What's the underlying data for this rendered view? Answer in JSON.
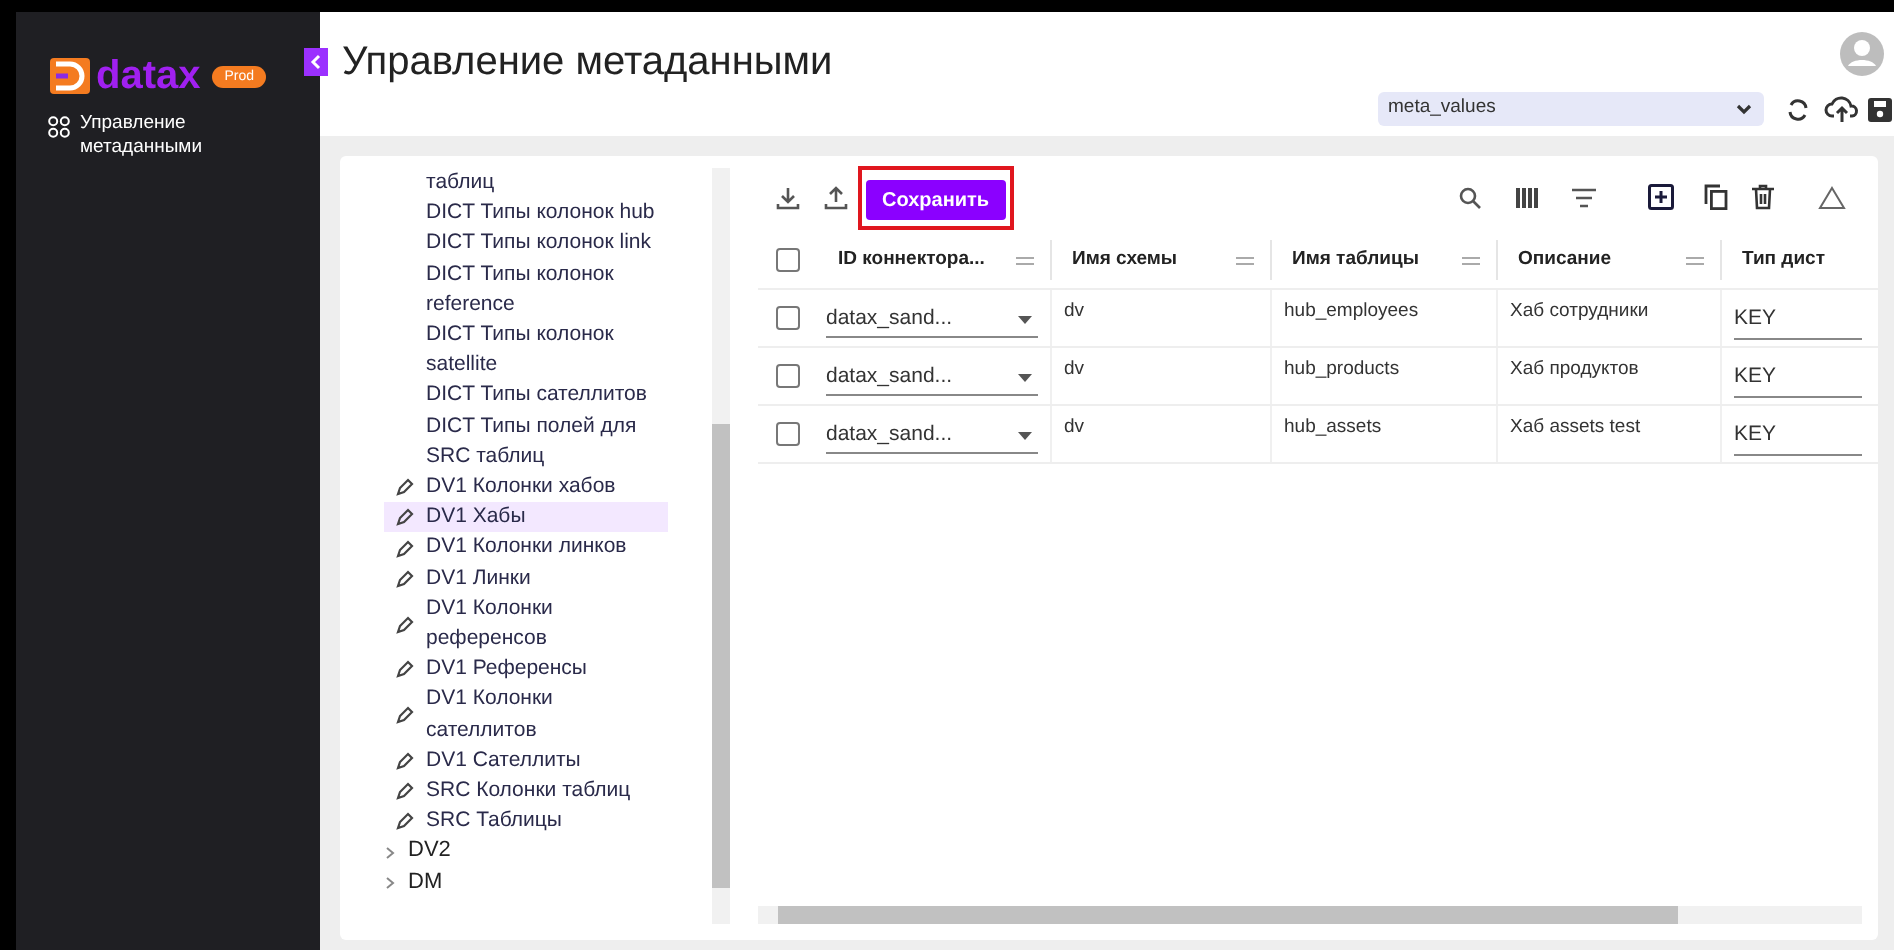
{
  "sidebar": {
    "logo": {
      "text": "datax",
      "badge": "Prod"
    },
    "items": [
      {
        "label": "Управление метаданными",
        "selected": true
      }
    ]
  },
  "header": {
    "title": "Управление метаданными",
    "schema_select": {
      "value": "meta_values"
    }
  },
  "tree": {
    "items": [
      {
        "kind": "leaf",
        "label": "таблиц",
        "selected": false
      },
      {
        "kind": "leaf",
        "label": "DICT Типы колонок hub",
        "selected": false
      },
      {
        "kind": "leaf",
        "label": "DICT Типы колонок link",
        "selected": false
      },
      {
        "kind": "leaf",
        "label": "DICT Типы колонок reference",
        "selected": false
      },
      {
        "kind": "leaf",
        "label": "DICT Типы колонок satellite",
        "selected": false
      },
      {
        "kind": "leaf",
        "label": "DICT Типы сателлитов",
        "selected": false
      },
      {
        "kind": "leaf",
        "label": "DICT Типы полей для SRC таблиц",
        "selected": false
      },
      {
        "kind": "edit",
        "label": "DV1 Колонки хабов",
        "selected": false
      },
      {
        "kind": "edit",
        "label": "DV1 Хабы",
        "selected": true
      },
      {
        "kind": "edit",
        "label": "DV1 Колонки линков",
        "selected": false
      },
      {
        "kind": "edit",
        "label": "DV1 Линки",
        "selected": false
      },
      {
        "kind": "edit",
        "label": "DV1 Колонки референсов",
        "selected": false
      },
      {
        "kind": "edit",
        "label": "DV1 Референсы",
        "selected": false
      },
      {
        "kind": "edit",
        "label": "DV1 Колонки сателлитов",
        "selected": false
      },
      {
        "kind": "edit",
        "label": "DV1 Сателлиты",
        "selected": false
      },
      {
        "kind": "edit",
        "label": "SRC Колонки таблиц",
        "selected": false
      },
      {
        "kind": "edit",
        "label": "SRC Таблицы",
        "selected": false
      },
      {
        "kind": "group",
        "label": "DV2",
        "expanded": false,
        "selected": false
      },
      {
        "kind": "group",
        "label": "DM",
        "expanded": false,
        "selected": false
      }
    ]
  },
  "toolbar": {
    "save_button": "Сохранить"
  },
  "table": {
    "all_checked": false,
    "columns": [
      "ID коннектора...",
      "Имя схемы",
      "Имя таблицы",
      "Описание",
      "Тип дист"
    ],
    "rows": [
      {
        "checked": false,
        "connector": "datax_sand...",
        "schema": "dv",
        "table": "hub_employees",
        "description": "Хаб сотрудники",
        "type": "KEY"
      },
      {
        "checked": false,
        "connector": "datax_sand...",
        "schema": "dv",
        "table": "hub_products",
        "description": "Хаб продуктов",
        "type": "KEY"
      },
      {
        "checked": false,
        "connector": "datax_sand...",
        "schema": "dv",
        "table": "hub_assets",
        "description": "Хаб assets test",
        "type": "KEY"
      }
    ]
  }
}
